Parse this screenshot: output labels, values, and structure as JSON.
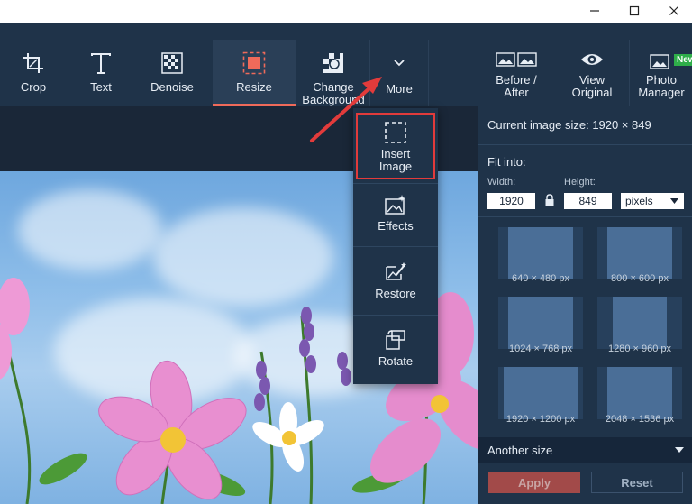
{
  "window": {
    "controls": [
      "minimize-icon",
      "maximize-icon",
      "close-icon"
    ]
  },
  "toolbar": {
    "crop": "Crop",
    "text": "Text",
    "denoise": "Denoise",
    "resize": "Resize",
    "change_background": "Change Background",
    "more": "More",
    "before_after": "Before / After",
    "view_original": "View Original",
    "photo_manager": "Photo Manager",
    "new_badge": "New"
  },
  "more_menu": {
    "insert_image": "Insert Image",
    "effects": "Effects",
    "restore": "Restore",
    "rotate": "Rotate"
  },
  "resize_panel": {
    "current_size": "Current image size: 1920 × 849",
    "fit_into": "Fit into:",
    "width_label": "Width:",
    "height_label": "Height:",
    "width_value": "1920",
    "height_value": "849",
    "unit": "pixels",
    "presets": [
      "640 × 480 px",
      "800 × 600 px",
      "1024 × 768 px",
      "1280 × 960 px",
      "1920 × 1200 px",
      "2048 × 1536 px"
    ],
    "another_size": "Another size",
    "apply": "Apply",
    "reset": "Reset"
  },
  "colors": {
    "toolbar_bg": "#1f3349",
    "accent": "#ef6a5a",
    "annotation": "#e23b3b"
  }
}
